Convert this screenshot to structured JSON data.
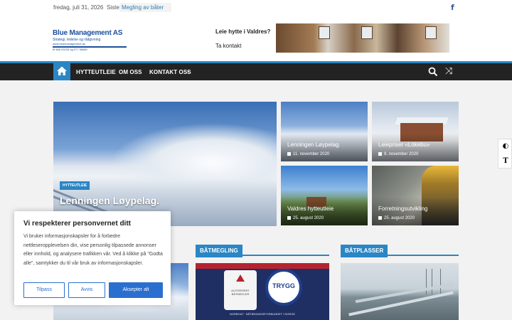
{
  "topbar": {
    "date": "fredag, juli 31, 2026",
    "latest_label": "Siste:",
    "latest_link": "Megling av båter"
  },
  "header": {
    "logo": {
      "name": "Blue Management AS",
      "tagline": "Strategi, ledelse og rådgivning",
      "web": "www.bluemanagement.as",
      "phone": "tlf 466 03233 og 977 96080"
    },
    "ad": {
      "question": "Leie hytte i Valdres?",
      "cta": "Ta kontakt"
    }
  },
  "nav": {
    "items": [
      "HYTTEUTLEIE",
      "OM OSS",
      "KONTAKT OSS"
    ]
  },
  "featured": {
    "category": "HYTTEUTLEIE",
    "title": "Lenningen Løypelag."
  },
  "tiles": [
    {
      "title": "Lenningen Løypelag.",
      "date": "11. november 2020"
    },
    {
      "title": "Leiepriser «Lokebu»",
      "date": "9. november 2020"
    },
    {
      "title": "Valdres hytteutleie",
      "date": "25. august 2020"
    },
    {
      "title": "Forretningsutvikling",
      "date": "25. august 2020"
    }
  ],
  "sections": {
    "boat_brokerage": "BÅTMEGLING",
    "boat_spots": "BÅTPLASSER",
    "badge_left": "AUTORISERT BÅTMEGLER",
    "badge_right": "TRYGG",
    "banner_footer": "NORBOAT · BÅTBRANSJEFORBUNDET I NORGE"
  },
  "cookie": {
    "heading": "Vi respekterer personvernet ditt",
    "text": "Vi bruker informasjonskapsler for å forbedre nettleseropplevelsen din, vise personlig tilpassede annonser eller innhold, og analysere trafikken vår. Ved å klikke på \"Godta alle\", samtykker du til vår bruk av informasjonskapsler.",
    "customize": "Tilpass",
    "reject": "Avvis",
    "accept": "Aksepter alt"
  },
  "colors": {
    "accent": "#2a86c5",
    "nav_bg": "#232323",
    "cookie_button": "#2a6fcf"
  },
  "icons": {
    "social": "facebook-icon",
    "home": "home-icon",
    "search": "search-icon",
    "random": "shuffle-icon",
    "contrast": "contrast-icon",
    "font_size": "font-size-icon"
  }
}
